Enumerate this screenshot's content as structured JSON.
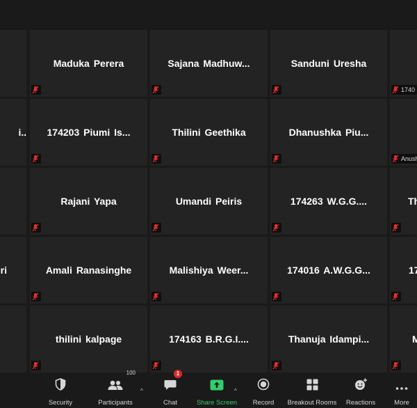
{
  "participants": [
    {
      "name": "Maduka Perera",
      "tag": ""
    },
    {
      "name": "Sajana  Madhuw...",
      "tag": ""
    },
    {
      "name": "Sanduni Uresha",
      "tag": ""
    },
    {
      "name": "",
      "tag": "1740"
    },
    {
      "name": "i...",
      "tag": ""
    },
    {
      "name": "174203  Piumi  Is...",
      "tag": ""
    },
    {
      "name": "Thilini Geethika",
      "tag": ""
    },
    {
      "name": "Dhanushka  Piu...",
      "tag": ""
    },
    {
      "name": "",
      "tag": "Anush"
    },
    {
      "name": "Rajani Yapa",
      "tag": ""
    },
    {
      "name": "Umandi Peiris",
      "tag": ""
    },
    {
      "name": "174263  W.G.G....",
      "tag": ""
    },
    {
      "name": "Th",
      "tag": ""
    },
    {
      "name": "ri",
      "tag": ""
    },
    {
      "name": "Amali Ranasinghe",
      "tag": ""
    },
    {
      "name": "Malishiya  Weer...",
      "tag": ""
    },
    {
      "name": "174016  A.W.G.G...",
      "tag": ""
    },
    {
      "name": "17",
      "tag": ""
    },
    {
      "name": "thilini kalpage",
      "tag": ""
    },
    {
      "name": "174163  B.R.G.I....",
      "tag": ""
    },
    {
      "name": "Thanuja  Idampi...",
      "tag": ""
    },
    {
      "name": "M",
      "tag": ""
    }
  ],
  "toolbar": {
    "security": {
      "label": "Security",
      "icon": "shield-icon"
    },
    "participants": {
      "label": "Participants",
      "count": "100",
      "icon": "participants-icon"
    },
    "chat": {
      "label": "Chat",
      "badge": "1",
      "icon": "chat-icon"
    },
    "share_screen": {
      "label": "Share Screen",
      "icon": "share-screen-icon"
    },
    "record": {
      "label": "Record",
      "icon": "record-icon"
    },
    "breakout_rooms": {
      "label": "Breakout Rooms",
      "icon": "breakout-rooms-icon"
    },
    "reactions": {
      "label": "Reactions",
      "icon": "reactions-icon"
    },
    "more": {
      "label": "More",
      "icon": "more-icon"
    }
  },
  "colors": {
    "accent_green": "#2fd06a",
    "mute_red": "#e0302c",
    "badge_red": "#e02828"
  }
}
